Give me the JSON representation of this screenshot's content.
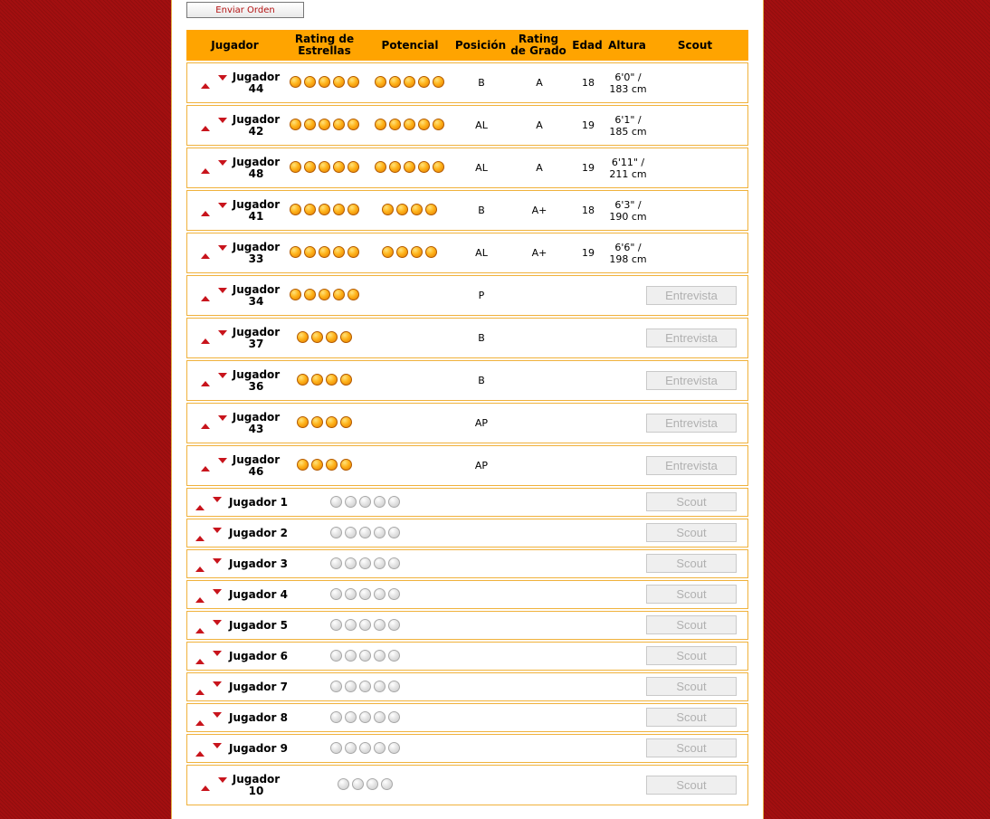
{
  "toolbar": {
    "submit_label": "Enviar Orden"
  },
  "columns": {
    "jugador": "Jugador",
    "rating_estrellas": "Rating de Estrellas",
    "potencial": "Potencial",
    "posicion": "Posición",
    "rating_grado": "Rating de Grado",
    "edad": "Edad",
    "altura": "Altura",
    "scout": "Scout"
  },
  "colors": {
    "header": "#ffa400",
    "accent": "#c8141c",
    "background": "#a30f10"
  },
  "rows": [
    {
      "name": "Jugador 44",
      "stars": 5,
      "potential": 5,
      "position": "B",
      "grade": "A",
      "age": "18",
      "height": "6'0\" / 183 cm",
      "action": ""
    },
    {
      "name": "Jugador 42",
      "stars": 5,
      "potential": 5,
      "position": "AL",
      "grade": "A",
      "age": "19",
      "height": "6'1\" / 185 cm",
      "action": ""
    },
    {
      "name": "Jugador 48",
      "stars": 5,
      "potential": 5,
      "position": "AL",
      "grade": "A",
      "age": "19",
      "height": "6'11\" / 211 cm",
      "action": ""
    },
    {
      "name": "Jugador 41",
      "stars": 5,
      "potential": 4,
      "position": "B",
      "grade": "A+",
      "age": "18",
      "height": "6'3\" / 190 cm",
      "action": ""
    },
    {
      "name": "Jugador 33",
      "stars": 5,
      "potential": 4,
      "position": "AL",
      "grade": "A+",
      "age": "19",
      "height": "6'6\" / 198 cm",
      "action": ""
    },
    {
      "name": "Jugador 34",
      "stars": 5,
      "potential": 0,
      "position": "P",
      "grade": "",
      "age": "",
      "height": "",
      "action": "Entrevista"
    },
    {
      "name": "Jugador 37",
      "stars": 4,
      "potential": 0,
      "position": "B",
      "grade": "",
      "age": "",
      "height": "",
      "action": "Entrevista"
    },
    {
      "name": "Jugador 36",
      "stars": 4,
      "potential": 0,
      "position": "B",
      "grade": "",
      "age": "",
      "height": "",
      "action": "Entrevista"
    },
    {
      "name": "Jugador 43",
      "stars": 4,
      "potential": 0,
      "position": "AP",
      "grade": "",
      "age": "",
      "height": "",
      "action": "Entrevista"
    },
    {
      "name": "Jugador 46",
      "stars": 4,
      "potential": 0,
      "position": "AP",
      "grade": "",
      "age": "",
      "height": "",
      "action": "Entrevista"
    },
    {
      "name": "Jugador 1",
      "unscouted": 5,
      "action": "Scout"
    },
    {
      "name": "Jugador 2",
      "unscouted": 5,
      "action": "Scout"
    },
    {
      "name": "Jugador 3",
      "unscouted": 5,
      "action": "Scout"
    },
    {
      "name": "Jugador 4",
      "unscouted": 5,
      "action": "Scout"
    },
    {
      "name": "Jugador 5",
      "unscouted": 5,
      "action": "Scout"
    },
    {
      "name": "Jugador 6",
      "unscouted": 5,
      "action": "Scout"
    },
    {
      "name": "Jugador 7",
      "unscouted": 5,
      "action": "Scout"
    },
    {
      "name": "Jugador 8",
      "unscouted": 5,
      "action": "Scout"
    },
    {
      "name": "Jugador 9",
      "unscouted": 5,
      "action": "Scout"
    },
    {
      "name": "Jugador 10",
      "unscouted": 4,
      "action": "Scout",
      "tall": true
    }
  ]
}
